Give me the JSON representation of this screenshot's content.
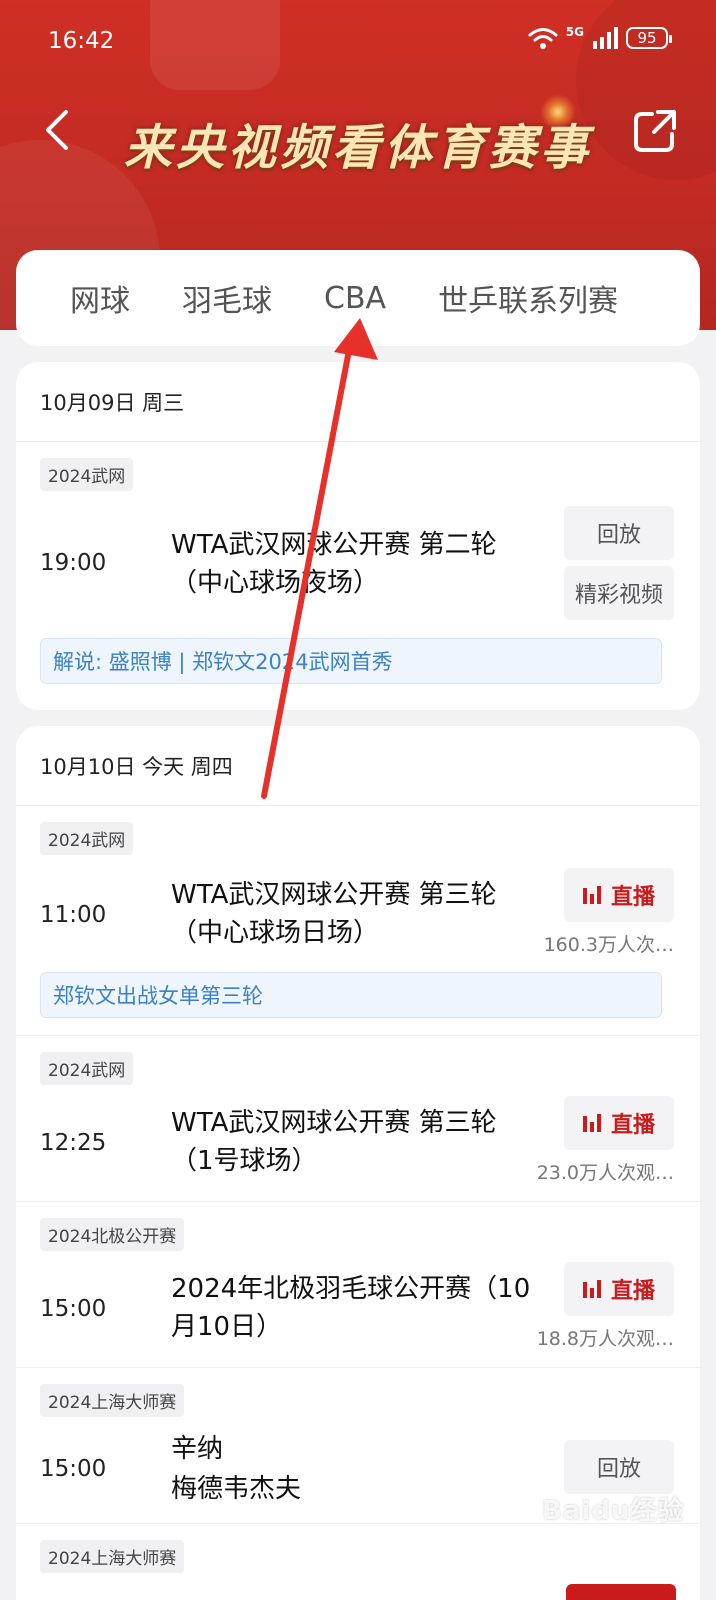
{
  "status_bar": {
    "time": "16:42",
    "network": "5G",
    "battery": "95"
  },
  "header": {
    "title": "来央视频看体育赛事"
  },
  "tabs": [
    {
      "label": "网球"
    },
    {
      "label": "羽毛球"
    },
    {
      "label": "CBA"
    },
    {
      "label": "世乒联系列赛"
    }
  ],
  "days": [
    {
      "date": "10月09日 周三",
      "matches": [
        {
          "tag": "2024武网",
          "time": "19:00",
          "title": "WTA武汉网球公开赛 第二轮（中心球场夜场）",
          "buttons": [
            "回放",
            "精彩视频"
          ],
          "note": "解说: 盛照博 | 郑钦文2024武网首秀"
        }
      ]
    },
    {
      "date": "10月10日 今天 周四",
      "matches": [
        {
          "tag": "2024武网",
          "time": "11:00",
          "title": "WTA武汉网球公开赛 第三轮（中心球场日场）",
          "live_label": "直播",
          "views": "160.3万人次…",
          "note": "郑钦文出战女单第三轮"
        },
        {
          "tag": "2024武网",
          "time": "12:25",
          "title": "WTA武汉网球公开赛 第三轮（1号球场）",
          "live_label": "直播",
          "views": "23.0万人次观…"
        },
        {
          "tag": "2024北极公开赛",
          "time": "15:00",
          "title": "2024年北极羽毛球公开赛（10月10日）",
          "live_label": "直播",
          "views": "18.8万人次观…"
        },
        {
          "tag": "2024上海大师赛",
          "time": "15:00",
          "title_line1": "辛纳",
          "title_line2": "梅德韦杰夫",
          "button": "回放"
        },
        {
          "tag": "2024上海大师赛"
        }
      ]
    }
  ],
  "watermark": "Baidu经验",
  "colors": {
    "header_red": "#c32b23",
    "live_red": "#c91b1b",
    "note_blue": "#3c82c4",
    "arrow_red": "#e8302a"
  }
}
